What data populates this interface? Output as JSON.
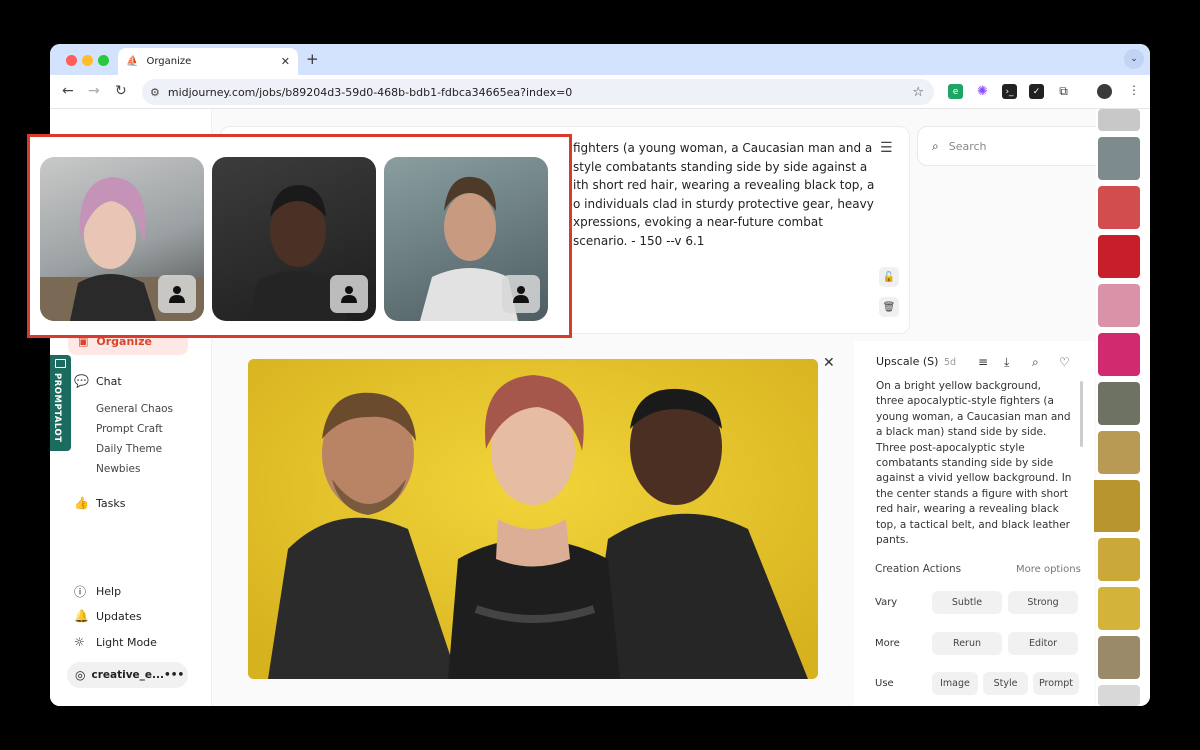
{
  "browser": {
    "tab_title": "Organize",
    "tab_close": "✕",
    "new_tab": "+",
    "url": "midjourney.com/jobs/b89204d3-59d0-468b-bdb1-fdbca34665ea?index=0",
    "tab_menu": "⌄",
    "colors": {
      "close": "#ff5f57",
      "minimize": "#febc2e",
      "zoom": "#28c840"
    }
  },
  "sidebar": {
    "organize_label": "Organize",
    "chat_label": "Chat",
    "channels": [
      "General Chaos",
      "Prompt Craft",
      "Daily Theme",
      "Newbies"
    ],
    "tasks_label": "Tasks",
    "help_label": "Help",
    "updates_label": "Updates",
    "light_mode_label": "Light Mode",
    "username": "creative_e...",
    "user_menu": "•••",
    "extension_label": "PROMPTALOT"
  },
  "prompt": {
    "text": "fighters (a young woman, a Caucasian man and a style combatants standing side by side against a ith short red hair, wearing a revealing black top, a o individuals clad in sturdy protective gear, heavy xpressions, evoking a near-future combat scenario. - 150 --v 6.1"
  },
  "search": {
    "placeholder": "Search"
  },
  "details": {
    "title": "Upscale (S)",
    "age": "5d",
    "description": "On a bright yellow background, three apocalyptic-style fighters (a young woman, a Caucasian man and a black man) stand side by side. Three post-apocalyptic style combatants standing side by side against a vivid yellow background. In the center stands a figure with short red hair, wearing a revealing black top, a tactical belt, and black leather pants.",
    "creation_actions_label": "Creation Actions",
    "more_options_label": "More options",
    "vary_label": "Vary",
    "vary_buttons": [
      "Subtle",
      "Strong"
    ],
    "more_label": "More",
    "more_buttons": [
      "Rerun",
      "Editor"
    ],
    "use_label": "Use",
    "use_buttons": [
      "Image",
      "Style",
      "Prompt"
    ]
  },
  "accent_color": "#d9442c"
}
